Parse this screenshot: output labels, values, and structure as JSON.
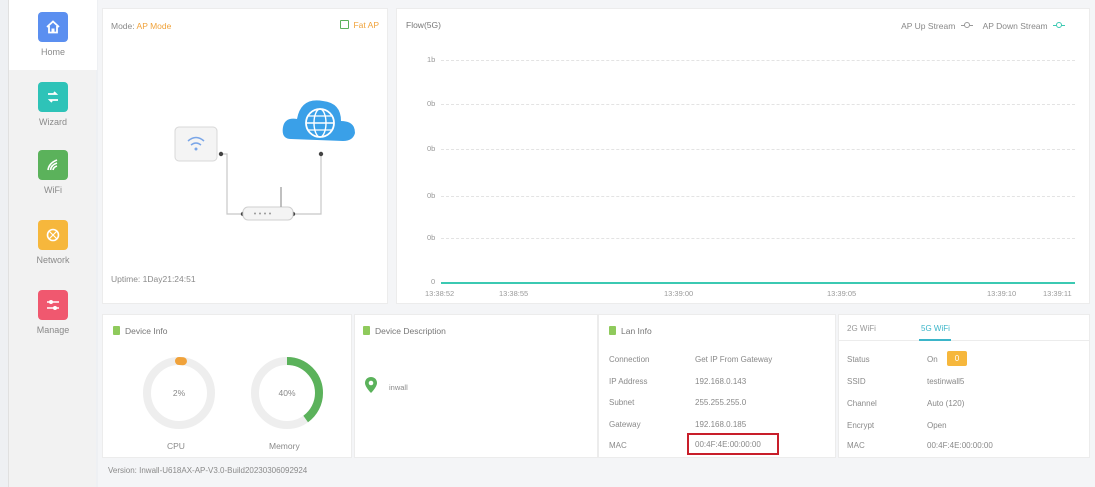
{
  "sidebar": {
    "items": [
      {
        "label": "Home",
        "icon": "home-icon",
        "color": "#5b8ff0"
      },
      {
        "label": "Wizard",
        "icon": "wizard-icon",
        "color": "#2ec3b8"
      },
      {
        "label": "WiFi",
        "icon": "wifi-icon",
        "color": "#5bb25b"
      },
      {
        "label": "Network",
        "icon": "network-icon",
        "color": "#f6b73c"
      },
      {
        "label": "Manage",
        "icon": "manage-icon",
        "color": "#f0586f"
      }
    ]
  },
  "mode_panel": {
    "mode_label": "Mode:",
    "mode_value": "AP Mode",
    "fit_ap": "Fat AP",
    "uptime": "Uptime: 1Day21:24:51"
  },
  "flow_panel": {
    "title": "Flow(5G)",
    "legend_up": "AP Up Stream",
    "legend_down": "AP Down Stream",
    "y_ticks": [
      "1b",
      "0b",
      "0b",
      "0b",
      "0b",
      "0"
    ],
    "x_ticks": [
      "13:38:52",
      "13:38:55",
      "13:39:00",
      "13:39:05",
      "13:39:10",
      "13:39:11"
    ],
    "line_color": "#3bc9b2"
  },
  "device_info": {
    "title": "Device Info",
    "cpu": {
      "label": "CPU",
      "percent_text": "2%",
      "value": 0.02,
      "color": "#f0a23a"
    },
    "memory": {
      "label": "Memory",
      "percent_text": "40%",
      "value": 0.4,
      "color": "#5bb25b"
    }
  },
  "device_description": {
    "title": "Device Description",
    "name": "inwall"
  },
  "lan_info": {
    "title": "Lan Info",
    "rows": [
      {
        "label": "Connection",
        "value": "Get IP From Gateway"
      },
      {
        "label": "IP Address",
        "value": "192.168.0.143"
      },
      {
        "label": "Subnet",
        "value": "255.255.255.0"
      },
      {
        "label": "Gateway",
        "value": "192.168.0.185"
      },
      {
        "label": "MAC",
        "value": "00:4F:4E:00:00:00"
      }
    ]
  },
  "wifi_info": {
    "tabs": [
      "2G WiFi",
      "5G WiFi"
    ],
    "active_tab": "5G WiFi",
    "rows": [
      {
        "label": "Status",
        "value": "On"
      },
      {
        "label": "SSID",
        "value": "testinwall5"
      },
      {
        "label": "Channel",
        "value": "Auto (120)"
      },
      {
        "label": "Encrypt",
        "value": "Open"
      },
      {
        "label": "MAC",
        "value": "00:4F:4E:00:00:00"
      }
    ],
    "status_toggle_text": "0"
  },
  "footer": {
    "version": "Version: Inwall-U618AX-AP-V3.0-Build20230306092924"
  }
}
